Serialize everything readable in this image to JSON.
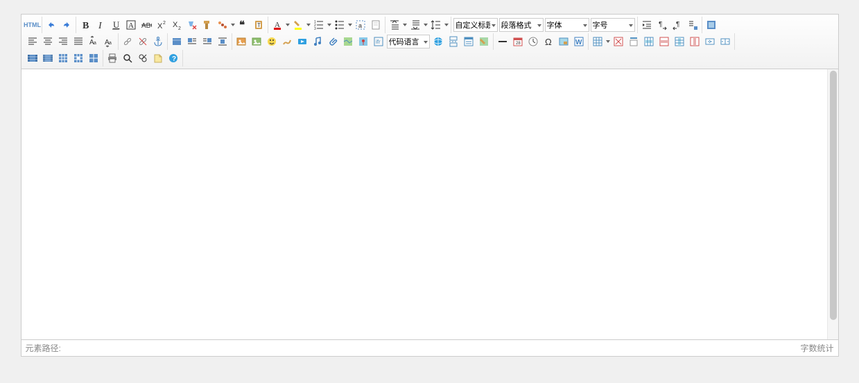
{
  "toolbar": {
    "html_label": "HTML",
    "custom_title": "自定义标题",
    "paragraph_format": "段落格式",
    "font_family": "字体",
    "font_size": "字号",
    "code_language": "代码语言"
  },
  "status": {
    "element_path": "元素路径:",
    "word_count": "字数统计"
  }
}
